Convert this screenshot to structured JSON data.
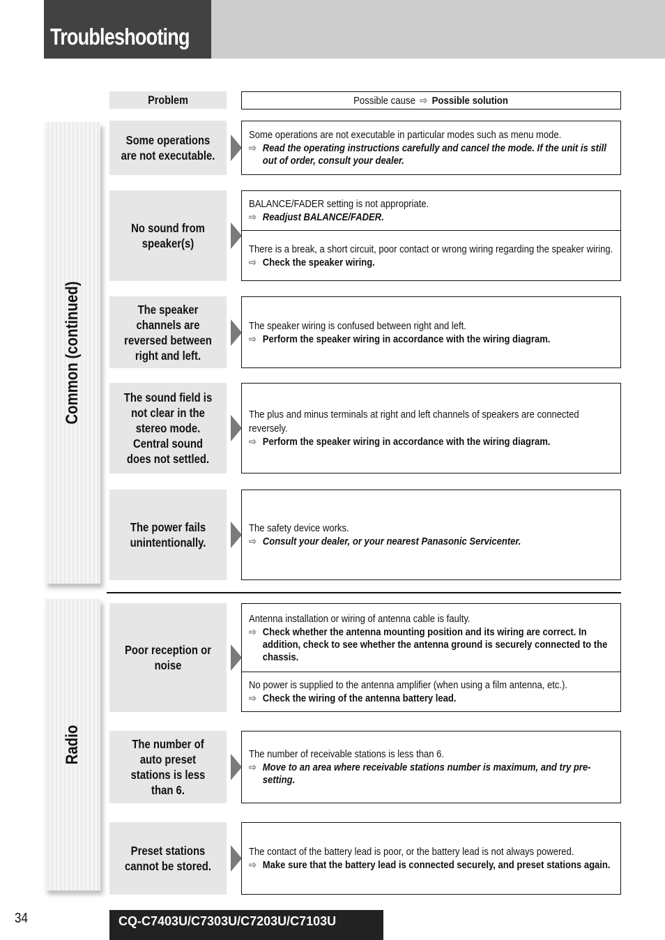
{
  "header": {
    "title": "Troubleshooting"
  },
  "columns": {
    "problem": "Problem",
    "cause": "Possible cause",
    "solution": "Possible solution",
    "arrow_icon": "⇨"
  },
  "sections": {
    "common": {
      "label": "Common (continued)"
    },
    "radio": {
      "label": "Radio"
    }
  },
  "rows": [
    {
      "problem": "Some operations are not executable.",
      "causes": [
        {
          "cause": "Some operations are not executable in particular modes such as menu mode.",
          "solution": "Read the operating instructions carefully and cancel the mode. If the unit is still out of order, consult your dealer.",
          "italic": true
        }
      ]
    },
    {
      "problem": "No sound from speaker(s)",
      "causes": [
        {
          "cause": "BALANCE/FADER setting is not appropriate.",
          "solution": "Readjust BALANCE/FADER.",
          "italic": true
        },
        {
          "cause": "There is a break, a short circuit, poor contact or wrong wiring regarding the speaker wiring.",
          "solution": "Check the speaker wiring.",
          "italic": false
        }
      ]
    },
    {
      "problem": "The speaker channels are reversed between right and left.",
      "causes": [
        {
          "cause": "The speaker wiring is confused between right and left.",
          "solution": "Perform the speaker wiring in accordance with the wiring diagram.",
          "italic": false
        }
      ]
    },
    {
      "problem": "The sound field is not clear in the stereo mode. Central sound does not settled.",
      "causes": [
        {
          "cause": "The plus and minus terminals at right and left channels of speakers are connected reversely.",
          "solution": "Perform the speaker wiring in accordance with the wiring diagram.",
          "italic": false
        }
      ]
    },
    {
      "problem": "The power fails unintentionally.",
      "causes": [
        {
          "cause": "The safety device works.",
          "solution": "Consult your dealer, or your nearest Panasonic Servicenter.",
          "italic": true
        }
      ]
    },
    {
      "problem": "Poor reception or noise",
      "causes": [
        {
          "cause": "Antenna installation or wiring of antenna cable is faulty.",
          "solution": "Check whether the antenna mounting position and its wiring are correct. In addition, check to see whether the antenna ground is securely connected to the chassis.",
          "italic": false
        },
        {
          "cause": "No power is supplied to the antenna amplifier (when using a film antenna, etc.).",
          "solution": "Check the wiring of the antenna battery lead.",
          "italic": false
        }
      ]
    },
    {
      "problem": "The number of auto preset stations is less than 6.",
      "causes": [
        {
          "cause": "The number of receivable stations is less than 6.",
          "solution": "Move to an area where receivable stations number is maximum, and try pre-setting.",
          "italic": true
        }
      ]
    },
    {
      "problem": "Preset stations cannot be stored.",
      "causes": [
        {
          "cause": "The contact of the battery lead is poor, or the battery lead is not always powered.",
          "solution": "Make sure that the battery lead is connected securely, and preset stations again.",
          "italic": false
        }
      ]
    }
  ],
  "footer": {
    "page_number": "34",
    "model": "CQ-C7403U/C7303U/C7203U/C7103U"
  }
}
